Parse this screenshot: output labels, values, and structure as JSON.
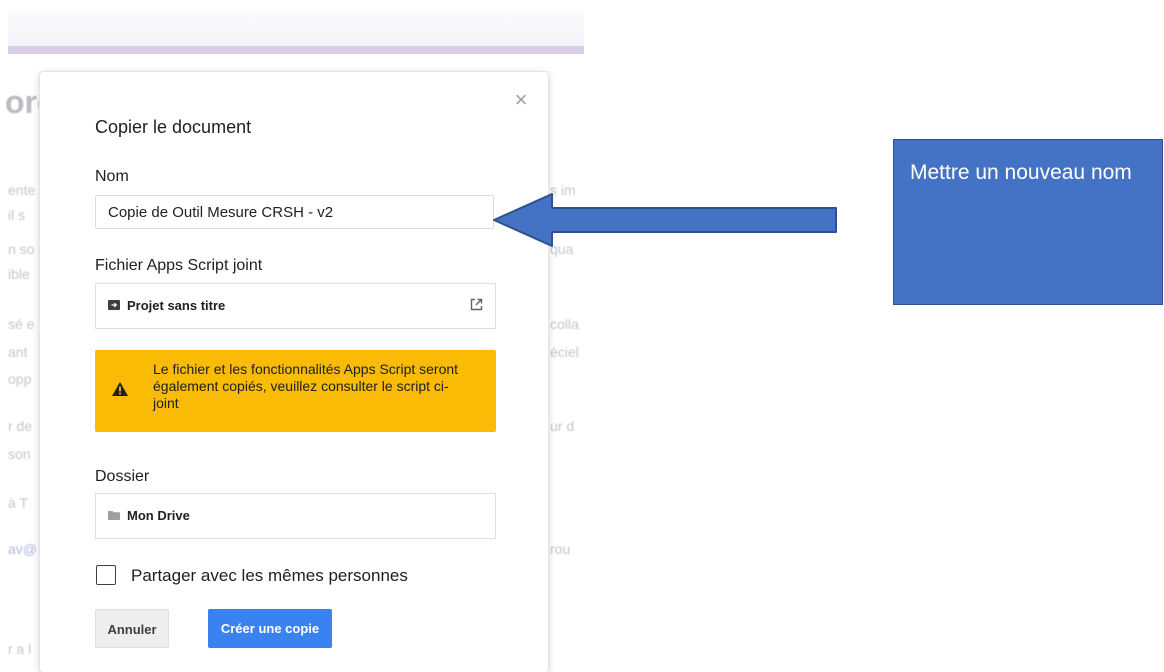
{
  "background": {
    "fragments": [
      "ore",
      "ente",
      "il s",
      "n so",
      "ible",
      "sé e",
      "ant",
      "opp",
      "r de",
      "son",
      "à T",
      "av@",
      "r a l",
      "s im",
      "qua",
      "colla",
      "éciel",
      "ur d",
      "rou"
    ]
  },
  "dialog": {
    "title": "Copier le document",
    "close_icon": "close-icon",
    "name_label": "Nom",
    "name_value": "Copie de Outil Mesure CRSH - v2",
    "script_label": "Fichier Apps Script joint",
    "script_name": "Projet sans titre",
    "script_icon": "apps-script-icon",
    "open_icon": "open-in-new-icon",
    "warning_text": "Le fichier et les fonctionnalités Apps Script seront également copiés, veuillez consulter le script ci-joint",
    "warning_icon": "warning-icon",
    "folder_label": "Dossier",
    "folder_name": "Mon Drive",
    "folder_icon": "folder-icon",
    "share_label": "Partager avec les mêmes personnes",
    "share_checked": false,
    "cancel_label": "Annuler",
    "create_label": "Créer une copie"
  },
  "annotation": {
    "callout_text": "Mettre un nouveau nom",
    "arrow_color": "#4472c4"
  },
  "colors": {
    "warning": "#f9bb06",
    "primary_button": "#3b82f1",
    "callout": "#4472c4"
  }
}
